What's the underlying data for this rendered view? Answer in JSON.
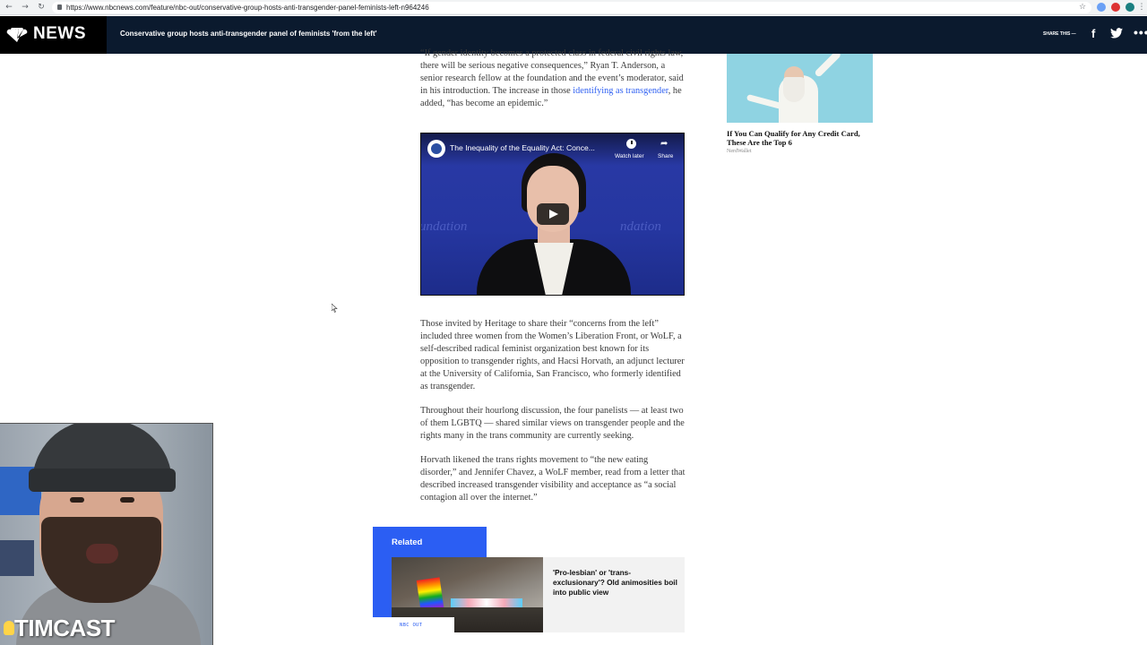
{
  "browser": {
    "url": "https://www.nbcnews.com/feature/nbc-out/conservative-group-hosts-anti-transgender-panel-feminists-left-n964246"
  },
  "header": {
    "logo_text": "NEWS",
    "title": "Conservative group hosts anti-transgender panel of feminists 'from the left'",
    "share_label": "SHARE THIS —",
    "more": "•••"
  },
  "article": {
    "para1_a": "“If gender identity becomes a protected class in federal civil rights law, there will be serious negative consequences,” Ryan T. Anderson, a senior research fellow at the foundation and the event’s moderator, said in his introduction. The increase in those ",
    "para1_link": "identifying as transgender",
    "para1_b": ", he added, “has become an epidemic.”",
    "para2": "Those invited by Heritage to share their “concerns from the left” included three women from the Women’s Liberation Front, or WoLF, a self-described radical feminist organization best known for its opposition to transgender rights, and Hacsi Horvath, an adjunct lecturer at the University of California, San Francisco, who formerly identified as transgender.",
    "para3": "Throughout their hourlong discussion, the four panelists — at least two of them LGBTQ — shared similar views on transgender people and the rights many in the trans community are currently seeking.",
    "para4": "Horvath likened the trans rights movement to “the new eating disorder,” and Jennifer Chavez, a WoLF member, read from a letter that described increased transgender visibility and acceptance as “a social contagion all over the internet.”"
  },
  "video": {
    "title": "The Inequality of the Equality Act: Conce...",
    "watch_later": "Watch later",
    "share": "Share",
    "backdrop_text_left": "undation",
    "backdrop_text_right": "ndation"
  },
  "related": {
    "label": "Related",
    "headline": "'Pro-lesbian' or 'trans-exclusionary'? Old animosities boil into public view",
    "section": "NBC OUT"
  },
  "ad": {
    "title": "If You Can Qualify for Any Credit Card, These Are the Top 6",
    "source": "NerdWallet"
  },
  "webcam": {
    "brand": "TIMCAST"
  },
  "colors": {
    "link": "#3061f2",
    "header_bg": "#0b1a2e",
    "related_blue": "#2b5ef3"
  }
}
